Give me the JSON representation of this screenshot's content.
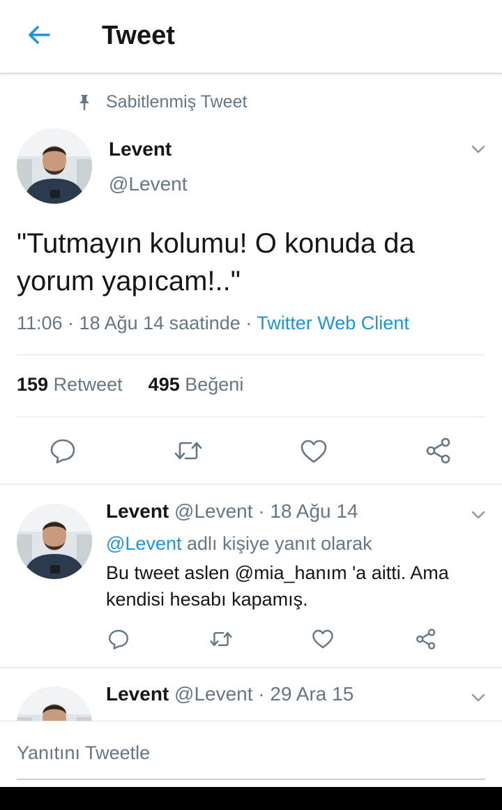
{
  "header": {
    "title": "Tweet"
  },
  "pinned": {
    "label": "Sabitlenmiş Tweet"
  },
  "tweet": {
    "name": "Levent",
    "handle": "@Levent",
    "text": "\"Tutmayın kolumu! O konuda da yorum yapıcam!..\"",
    "time": "11:06 · 18 Ağu 14 saatinde · ",
    "client": "Twitter Web Client",
    "retweet_count": "159",
    "retweet_label": "Retweet",
    "like_count": "495",
    "like_label": "Beğeni"
  },
  "replies": [
    {
      "name": "Levent",
      "handle": "@Levent · 18 Ağu 14",
      "reply_to_mention": "@Levent",
      "reply_to_suffix": " adlı kişiye yanıt olarak",
      "text": "Bu tweet aslen @mia_hanım 'a aitti. Ama kendisi hesabı kapamış."
    },
    {
      "name": "Levent",
      "handle": "@Levent · 29 Ara 15"
    }
  ],
  "compose": {
    "placeholder": "Yanıtını Tweetle"
  },
  "colors": {
    "accent": "#1b95e0",
    "secondary_text": "#657786",
    "primary_text": "#14171a"
  },
  "icons": [
    "arrow-left-icon",
    "pin-icon",
    "chevron-down-icon",
    "reply-icon",
    "retweet-icon",
    "heart-icon",
    "share-icon"
  ]
}
